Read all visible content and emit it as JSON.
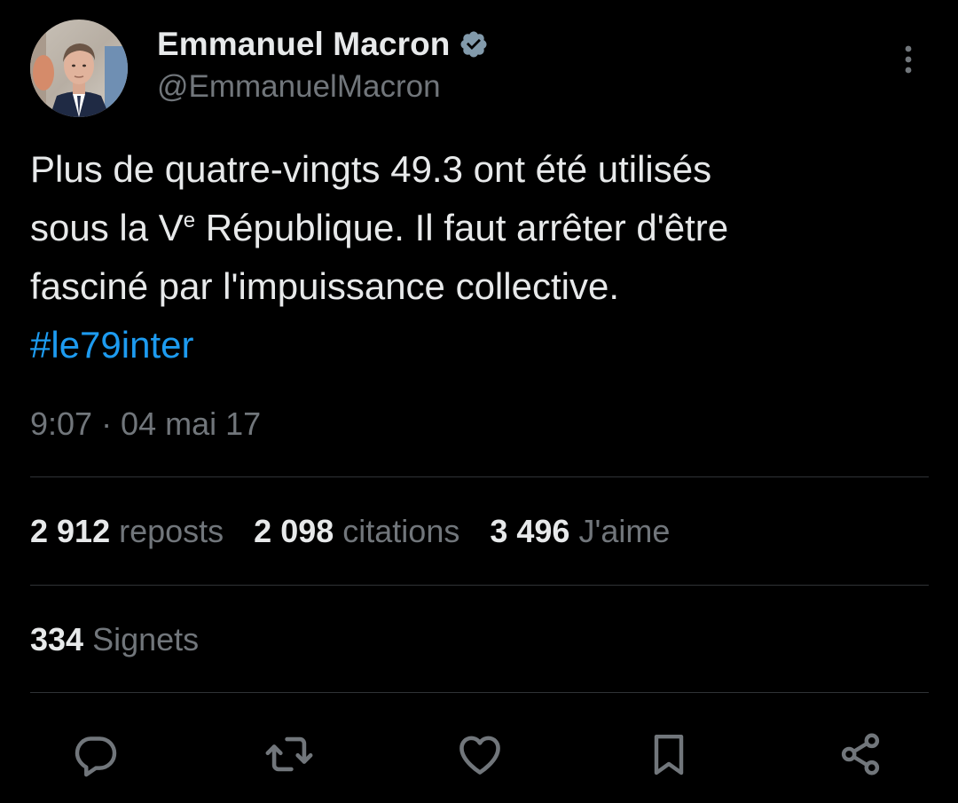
{
  "author": {
    "name": "Emmanuel Macron",
    "handle": "@EmmanuelMacron",
    "verified": true
  },
  "tweet": {
    "line1": "Plus de quatre-vingts 49.3 ont été utilisés",
    "line2_before": "sous la V",
    "line2_sup": "e",
    "line2_after": " République. Il faut arrêter d'être",
    "line3": "fasciné par l'impuissance collective.",
    "hashtag": "#le79inter",
    "timestamp": "9:07 · 04 mai 17"
  },
  "stats": {
    "reposts_count": "2 912",
    "reposts_label": "reposts",
    "quotes_count": "2 098",
    "quotes_label": "citations",
    "likes_count": "3 496",
    "likes_label": "J'aime",
    "bookmarks_count": "334",
    "bookmarks_label": "Signets"
  },
  "actions": [
    "reply-icon",
    "repost-icon",
    "like-icon",
    "bookmark-icon",
    "share-icon"
  ],
  "colors": {
    "background": "#000000",
    "text": "#e7e9ea",
    "muted": "#71767b",
    "accent": "#1d9bf0",
    "divider": "#2f3336",
    "verified": "#829aab"
  }
}
